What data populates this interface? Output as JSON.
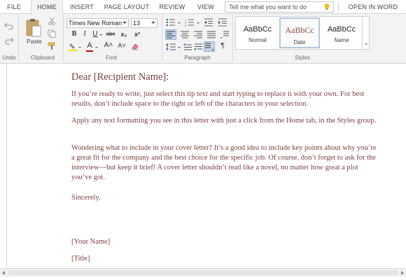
{
  "tabs": [
    {
      "label": "FILE"
    },
    {
      "label": "HOME"
    },
    {
      "label": "INSERT"
    },
    {
      "label": "PAGE LAYOUT"
    },
    {
      "label": "REVIEW"
    },
    {
      "label": "VIEW"
    }
  ],
  "tell_me": {
    "placeholder": "Tell me what you want to do"
  },
  "open_in_word": "OPEN IN WORD",
  "ribbon": {
    "undo_label": "Undo",
    "clipboard": {
      "label": "Clipboard",
      "paste_label": "Paste"
    },
    "font": {
      "label": "Font",
      "name": "Times New Roman",
      "size": "13",
      "bold": "B",
      "italic": "I",
      "underline": "U",
      "strikethrough": "abc",
      "subscript": "x₂",
      "superscript": "x²",
      "font_color": "A",
      "grow": "A˄",
      "shrink": "A˅"
    },
    "paragraph": {
      "label": "Paragraph",
      "rtl": "¶"
    },
    "styles": {
      "label": "Styles",
      "items": [
        {
          "preview": "AaBbCc",
          "name": "Normal"
        },
        {
          "preview": "AaBbCc",
          "name": "Date"
        },
        {
          "preview": "AaBbCc",
          "name": "Name"
        }
      ]
    }
  },
  "document": {
    "salutation": "Dear [Recipient Name]:",
    "paragraphs": [
      "If you’re ready to write, just select this tip text and start typing to replace it with your own. For best results, don’t include space to the right or left of the characters in your selection.",
      "Apply any text formatting you see in this letter with just a click from the Home tab, in the Styles group.",
      "Wondering what to include in your cover letter? It’s a good idea to include key points about why you’re a great fit for the company and the best choice for the specific job. Of course, don’t forget to ask for the interview—but keep it brief! A cover letter shouldn’t read like a novel, no matter how great a plot you’ve got."
    ],
    "closing": "Sincerely,",
    "your_name": "[Your Name]",
    "title": "[Title]"
  },
  "colors": {
    "body_text": "#7a3e3e",
    "ribbon_bg": "#f3f3f3",
    "accent_blue": "#2b579a",
    "highlight_yellow": "#ffe000",
    "font_color_red": "#c00000"
  }
}
